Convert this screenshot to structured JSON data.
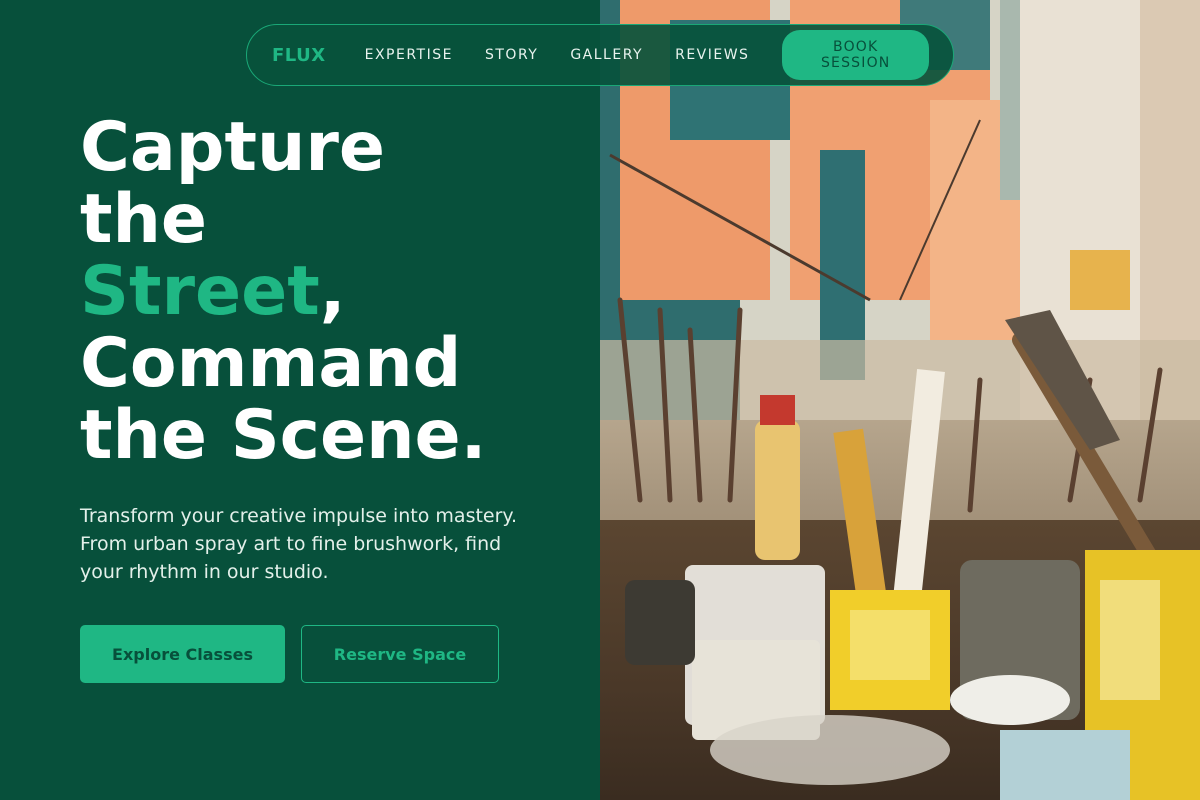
{
  "nav": {
    "logo": "FLUX",
    "links": [
      "EXPERTISE",
      "STORY",
      "GALLERY",
      "REVIEWS"
    ],
    "cta": "BOOK SESSION"
  },
  "hero": {
    "title_line1": "Capture",
    "title_line2": "the",
    "title_accent": "Street",
    "title_comma": ",",
    "title_line4": "Command",
    "title_line5": "the Scene.",
    "description": "Transform your creative impulse into mastery. From urban spray art to fine brushwork, find your rhythm in our studio.",
    "primary_button": "Explore Classes",
    "secondary_button": "Reserve Space"
  },
  "colors": {
    "background": "#07503b",
    "accent": "#1fb784",
    "text": "#ffffff"
  }
}
